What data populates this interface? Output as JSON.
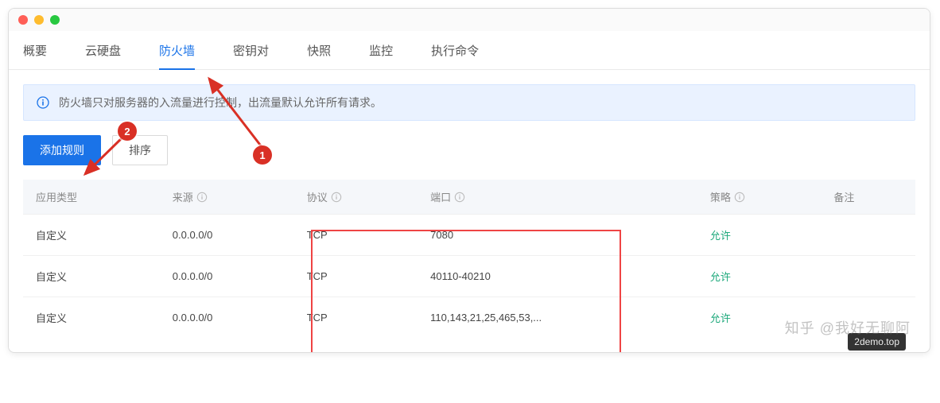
{
  "tabs": [
    {
      "label": "概要"
    },
    {
      "label": "云硬盘"
    },
    {
      "label": "防火墙"
    },
    {
      "label": "密钥对"
    },
    {
      "label": "快照"
    },
    {
      "label": "监控"
    },
    {
      "label": "执行命令"
    }
  ],
  "info_banner": "防火墙只对服务器的入流量进行控制，出流量默认允许所有请求。",
  "buttons": {
    "add_rule": "添加规则",
    "sort": "排序"
  },
  "columns": {
    "app_type": "应用类型",
    "source": "来源",
    "protocol": "协议",
    "port": "端口",
    "policy": "策略",
    "remark": "备注"
  },
  "rows": [
    {
      "app_type": "自定义",
      "source": "0.0.0.0/0",
      "protocol": "TCP",
      "port": "7080",
      "policy": "允许",
      "remark": ""
    },
    {
      "app_type": "自定义",
      "source": "0.0.0.0/0",
      "protocol": "TCP",
      "port": "40110-40210",
      "policy": "允许",
      "remark": ""
    },
    {
      "app_type": "自定义",
      "source": "0.0.0.0/0",
      "protocol": "TCP",
      "port": "110,143,21,25,465,53,...",
      "policy": "允许",
      "remark": ""
    }
  ],
  "callouts": {
    "one": "1",
    "two": "2"
  },
  "tooltip": "2demo.top",
  "watermark": "知乎 @我好无聊阿"
}
